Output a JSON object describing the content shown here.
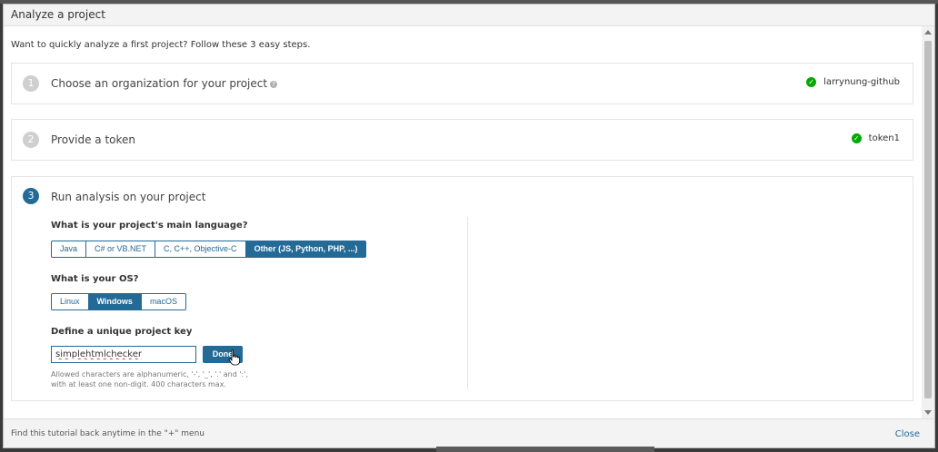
{
  "modal": {
    "title": "Analyze a project",
    "intro": "Want to quickly analyze a first project? Follow these 3 easy steps."
  },
  "steps": [
    {
      "number": "1",
      "title": "Choose an organization for your project",
      "help_icon": "?",
      "result": "larrynung-github"
    },
    {
      "number": "2",
      "title": "Provide a token",
      "result": "token1"
    },
    {
      "number": "3",
      "title": "Run analysis on your project"
    }
  ],
  "analysis": {
    "language_label": "What is your project's main language?",
    "languages": [
      "Java",
      "C# or VB.NET",
      "C, C++, Objective-C",
      "Other (JS, Python, PHP, ...)"
    ],
    "language_selected": "Other (JS, Python, PHP, ...)",
    "os_label": "What is your OS?",
    "os_options": [
      "Linux",
      "Windows",
      "macOS"
    ],
    "os_selected": "Windows",
    "key_label": "Define a unique project key",
    "key_value": "simplehtmlchecker",
    "done_label": "Done",
    "hint_line1": "Allowed characters are alphanumeric, '-', '_', '.' and ':',",
    "hint_line2": "with at least one non-digit. 400 characters max."
  },
  "footer": {
    "text": "Find this tutorial back anytime in the \"+\" menu",
    "close_label": "Close"
  },
  "icons": {
    "check": "check-circle-icon",
    "help": "help-icon",
    "cursor": "hand-cursor-icon"
  },
  "colors": {
    "accent": "#236a97",
    "success": "#00aa00"
  }
}
